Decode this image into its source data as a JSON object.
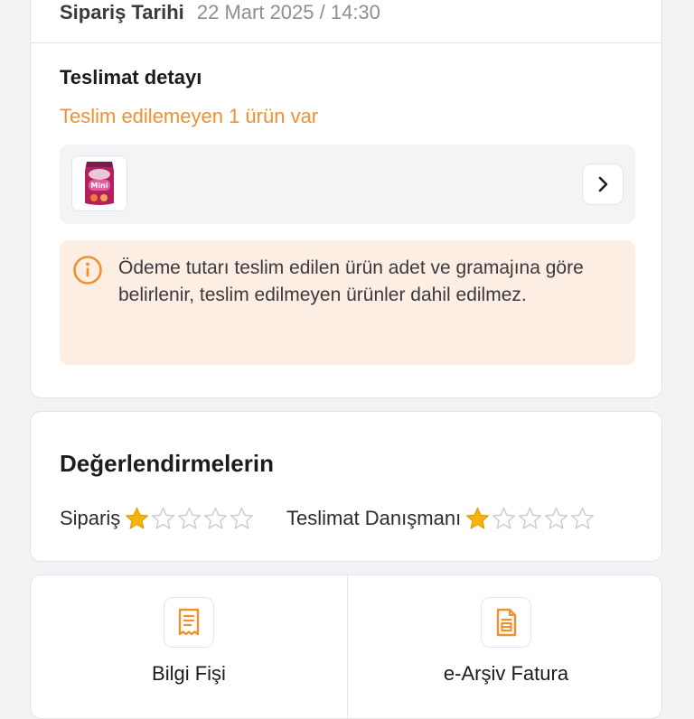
{
  "order": {
    "date_label": "Sipariş Tarihi",
    "date_value": "22 Mart 2025 / 14:30"
  },
  "delivery": {
    "title": "Teslimat detayı",
    "undelivered_text": "Teslim edilemeyen 1 ürün var",
    "info_text": "Ödeme tutarı teslim edilen ürün adet ve gramajına göre belirlenir, teslim edilmeyen ürünler dahil edilmez.",
    "product_image_text": "Mini"
  },
  "ratings": {
    "title": "Değerlendirmelerin",
    "items": [
      {
        "label": "Sipariş",
        "rating": 1,
        "max": 5
      },
      {
        "label": "Teslimat Danışmanı",
        "rating": 1,
        "max": 5
      }
    ]
  },
  "documents": [
    {
      "label": "Bilgi Fişi",
      "icon": "receipt-icon"
    },
    {
      "label": "e-Arşiv Fatura",
      "icon": "invoice-icon"
    }
  ],
  "colors": {
    "accent_orange": "#f0902e",
    "star_filled": "#f5b50a",
    "star_empty": "#c9cbd0",
    "info_bg": "#fdeee3"
  }
}
